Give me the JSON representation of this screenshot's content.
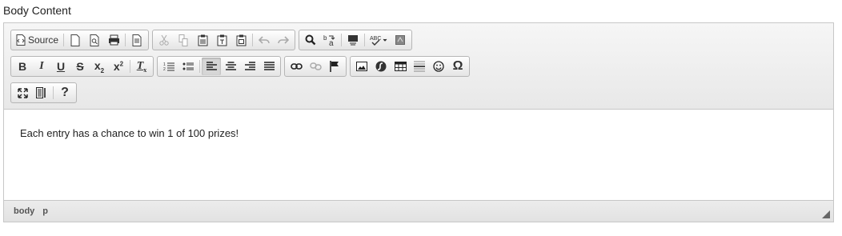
{
  "label": "Body Content",
  "toolbar": {
    "source_label": "Source"
  },
  "content": {
    "text": "Each entry has a chance to win 1 of 100 prizes!"
  },
  "statusbar": {
    "path": [
      "body",
      "p"
    ]
  },
  "buttons": {
    "subscript": "x",
    "superscript": "x",
    "help": "?",
    "special_char": "Ω",
    "remove_format": "I"
  }
}
